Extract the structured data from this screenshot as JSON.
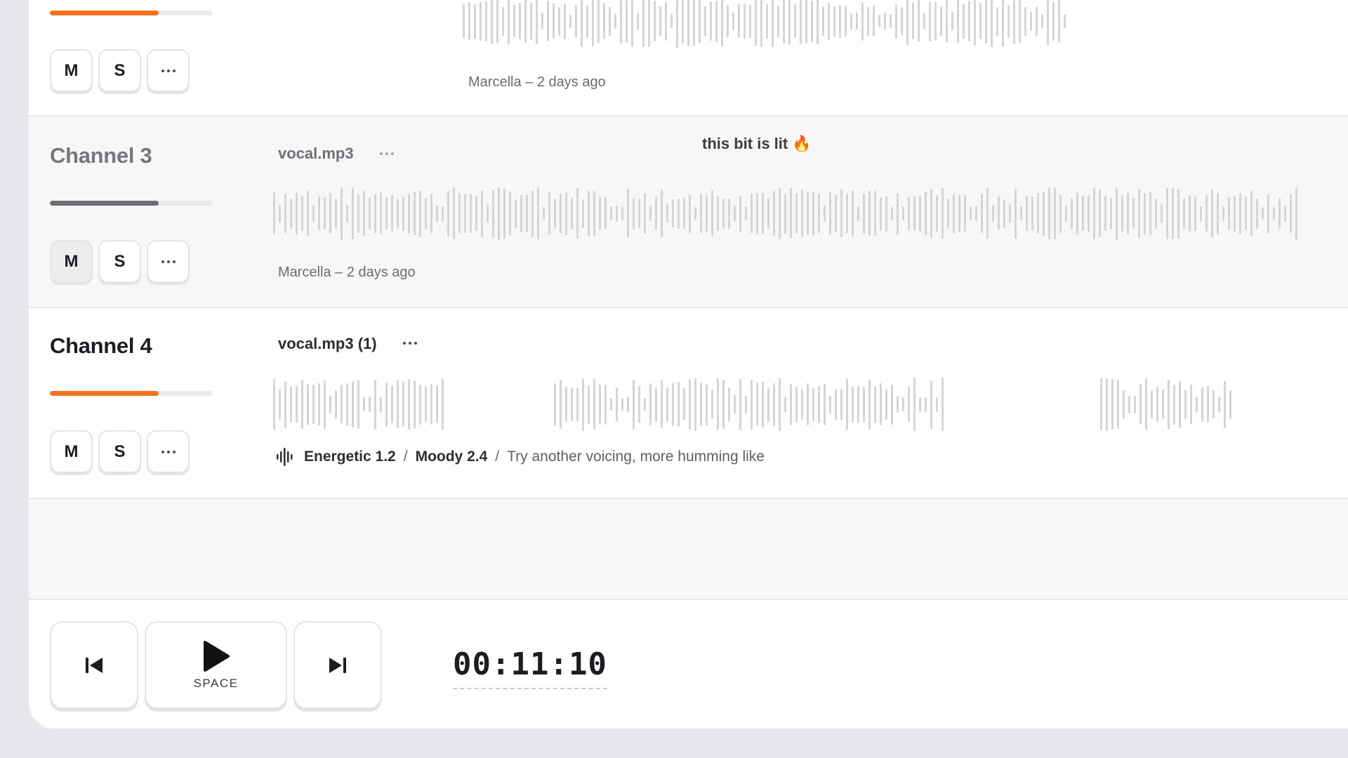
{
  "channels": [
    {
      "name": "",
      "volume": 0.67,
      "mute_label": "M",
      "solo_label": "S",
      "clip_meta": "Marcella – 2 days ago"
    },
    {
      "name": "Channel 3",
      "volume": 0.67,
      "mute_label": "M",
      "solo_label": "S",
      "mute_active": true,
      "clip_name": "vocal.mp3",
      "comment": "this bit is lit 🔥",
      "clip_meta": "Marcella – 2 days ago"
    },
    {
      "name": "Channel 4",
      "volume": 0.67,
      "mute_label": "M",
      "solo_label": "S",
      "clip_name": "vocal.mp3 (1)",
      "tags": {
        "tag1": "Energetic 1.2",
        "tag2": "Moody 2.4",
        "note": "Try another voicing, more humming like",
        "separator": "/"
      }
    }
  ],
  "transport": {
    "space_label": "SPACE",
    "timecode": "00:11:10"
  },
  "icons": {
    "prev": "skip-previous-icon",
    "play": "play-icon",
    "next": "skip-next-icon",
    "more": "more-dots-icon",
    "waveform": "waveform-icon"
  },
  "colors": {
    "accent": "#f4711e",
    "muted_fill": "#6e6f73",
    "wave": "#d4d5d8"
  }
}
